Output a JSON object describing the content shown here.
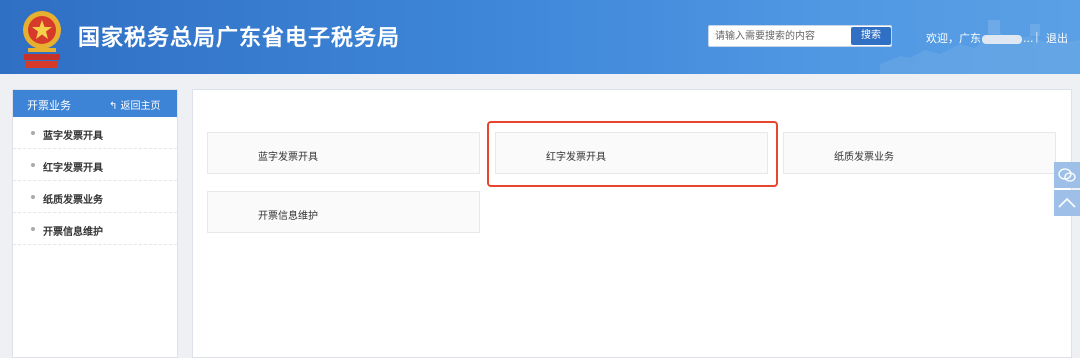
{
  "header": {
    "site_title": "国家税务总局广东省电子税务局",
    "search_placeholder": "请输入需要搜索的内容",
    "search_button": "搜索",
    "welcome_prefix": "欢迎，广东",
    "welcome_suffix": "...",
    "separator": "|",
    "logout": "退出"
  },
  "sidebar": {
    "title": "开票业务",
    "back_label": "↰ 返回主页",
    "items": [
      {
        "label": "蓝字发票开具"
      },
      {
        "label": "红字发票开具"
      },
      {
        "label": "纸质发票业务"
      },
      {
        "label": "开票信息维护"
      }
    ]
  },
  "main": {
    "cards": [
      {
        "label": "蓝字发票开具"
      },
      {
        "label": "红字发票开具"
      },
      {
        "label": "纸质发票业务"
      },
      {
        "label": "开票信息维护"
      }
    ]
  },
  "float_tools": [
    "wechat-icon",
    "back-to-top-icon"
  ],
  "colors": {
    "header_blue": "#3e86d8",
    "sidebar_head": "#3d83d6",
    "highlight_red": "#e8442e"
  }
}
